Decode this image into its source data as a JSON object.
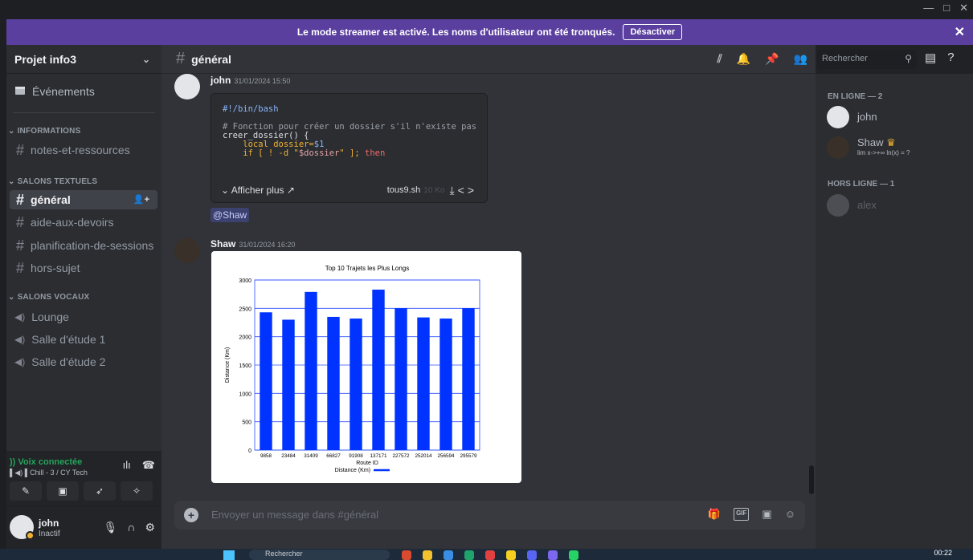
{
  "window": {
    "minimize": "—",
    "maximize": "□",
    "close": "✕"
  },
  "banner": {
    "text": "Le mode streamer est activé. Les noms d'utilisateur ont été tronqués.",
    "button": "Désactiver",
    "close": "✕"
  },
  "server": {
    "name": "Projet info3"
  },
  "sidebar": {
    "events_label": "Événements",
    "categories": {
      "info": "INFORMATIONS",
      "text": "SALONS TEXTUELS",
      "voice": "SALONS VOCAUX"
    },
    "info_channels": [
      "notes-et-ressources"
    ],
    "text_channels": [
      "général",
      "aide-aux-devoirs",
      "planification-de-sessions",
      "hors-sujet"
    ],
    "voice_channels": [
      "Lounge",
      "Salle d'étude 1",
      "Salle d'étude 2"
    ]
  },
  "voice": {
    "status": "Voix connectée",
    "channel": "Chill - 3 / CY Tech"
  },
  "user": {
    "name": "john",
    "status": "Inactif"
  },
  "channel": {
    "name": "général"
  },
  "search": {
    "placeholder": "Rechercher"
  },
  "messages": [
    {
      "author": "john",
      "time": "31/01/2024 15:50"
    },
    {
      "author": "Shaw",
      "time": "31/01/2024 16:20"
    }
  ],
  "code": {
    "line1": "#!/bin/bash",
    "comment": "# Fonction pour créer un dossier s'il n'existe pas",
    "line3": "creer_dossier() {",
    "line4_a": "    local dossier=",
    "line4_b": "$1",
    "line5_a": "    if [ ! -d \"",
    "line5_b": "$dossier",
    "line5_c": "\" ]; ",
    "line5_d": "then",
    "expand": "Afficher plus",
    "filename": "tous9.sh",
    "filesize": "10 Ko"
  },
  "mention": "@Shaw",
  "composer": {
    "placeholder": "Envoyer un message dans #général"
  },
  "members": {
    "online_header": "EN LIGNE — 2",
    "offline_header": "HORS LIGNE — 1",
    "online": [
      {
        "name": "john",
        "sub": ""
      },
      {
        "name": "Shaw",
        "sub": "lim x->+∞ ln(x) = ?"
      }
    ],
    "offline": [
      {
        "name": "alex"
      }
    ]
  },
  "taskbar": {
    "search": "Rechercher",
    "time": "00:22"
  },
  "chart_data": {
    "type": "bar",
    "title": "Top 10 Trajets les Plus Longs",
    "xlabel": "Route ID",
    "ylabel": "Distance (Km)",
    "legend": "Distance (Km)",
    "legend_position": "bottom",
    "categories": [
      "9858",
      "23484",
      "31409",
      "66827",
      "91908",
      "137171",
      "227572",
      "252014",
      "256594",
      "295579"
    ],
    "values": [
      2430,
      2300,
      2790,
      2350,
      2320,
      2830,
      2500,
      2340,
      2320,
      2500
    ],
    "ylim": [
      0,
      3000
    ],
    "yticks": [
      0,
      500,
      1000,
      1500,
      2000,
      2500,
      3000
    ],
    "bar_color": "#0033ff"
  }
}
